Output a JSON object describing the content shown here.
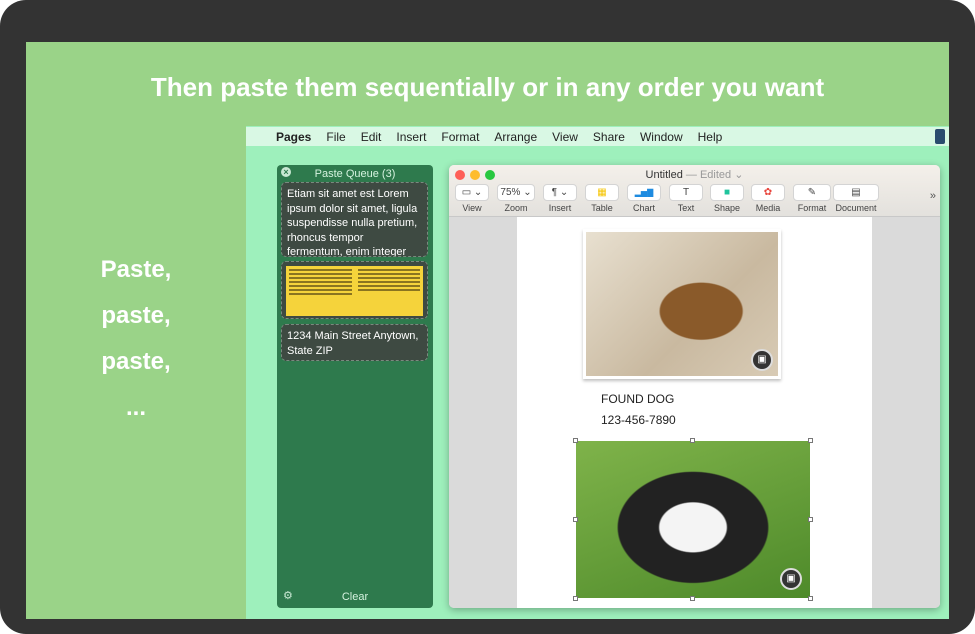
{
  "headline": "Then paste them sequentially or in any order you want",
  "side_text": [
    "Paste,",
    "paste,",
    "paste,",
    "..."
  ],
  "menubar": {
    "app": "Pages",
    "items": [
      "File",
      "Edit",
      "Insert",
      "Format",
      "Arrange",
      "View",
      "Share",
      "Window",
      "Help"
    ]
  },
  "queue": {
    "title": "Paste Queue (3)",
    "items": [
      {
        "type": "text",
        "text": "Etiam sit amet est Lorem ipsum dolor sit amet, ligula suspendisse nulla pretium, rhoncus tempor fermentum, enim integer a..."
      },
      {
        "type": "document"
      },
      {
        "type": "text",
        "text": "1234 Main Street Anytown, State ZIP"
      }
    ],
    "clear_label": "Clear"
  },
  "window": {
    "title": "Untitled",
    "edited": "— Edited ⌄",
    "toolbar": [
      {
        "icon": "sidebar-icon",
        "glyph": "▭ ⌄",
        "label": "View"
      },
      {
        "icon": "zoom-select",
        "glyph": "75% ⌄",
        "label": "Zoom"
      },
      {
        "icon": "paragraph-icon",
        "glyph": "¶ ⌄",
        "label": "Insert"
      },
      {
        "icon": "table-icon",
        "glyph": "▦",
        "label": "Table"
      },
      {
        "icon": "chart-icon",
        "glyph": "▂▅▇",
        "label": "Chart"
      },
      {
        "icon": "text-icon",
        "glyph": "T",
        "label": "Text"
      },
      {
        "icon": "shape-icon",
        "glyph": "■",
        "label": "Shape"
      },
      {
        "icon": "media-icon",
        "glyph": "✿",
        "label": "Media"
      },
      {
        "icon": "format-icon",
        "glyph": "✎",
        "label": "Format"
      },
      {
        "icon": "document-icon",
        "glyph": "▤",
        "label": "Document"
      }
    ],
    "more": "»"
  },
  "document": {
    "caption1": "FOUND DOG",
    "caption2": "123-456-7890"
  },
  "colors": {
    "stage": "#9ad388",
    "queue": "#2e7a4d",
    "close": "#fe5f57",
    "minimize": "#febc2e",
    "zoom": "#28c840"
  }
}
